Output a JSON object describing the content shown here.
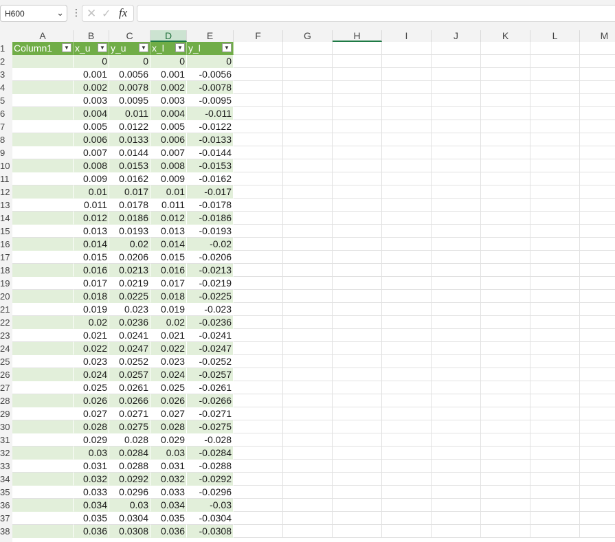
{
  "formula_bar": {
    "name_box": "H600",
    "chevron_icon": "chevron-down-icon",
    "more_icon": "more-dots-icon",
    "cancel_icon": "close-icon",
    "enter_icon": "check-icon",
    "fx_label": "fx",
    "formula_value": ""
  },
  "grid": {
    "columns": [
      "A",
      "B",
      "C",
      "D",
      "E",
      "F",
      "G",
      "H",
      "I",
      "J",
      "K",
      "L",
      "M"
    ],
    "selected_column": "D",
    "active_column": "H",
    "table_header_row": 1,
    "table_headers": [
      "Column1",
      "x_u",
      "y_u",
      "x_l",
      "y_l"
    ],
    "filter_icon": "dropdown-arrow-icon",
    "rows": [
      {
        "num": "2",
        "cells": [
          "",
          "0",
          "0",
          "0",
          "0"
        ]
      },
      {
        "num": "3",
        "cells": [
          "",
          "0.001",
          "0.0056",
          "0.001",
          "-0.0056"
        ]
      },
      {
        "num": "4",
        "cells": [
          "",
          "0.002",
          "0.0078",
          "0.002",
          "-0.0078"
        ]
      },
      {
        "num": "5",
        "cells": [
          "",
          "0.003",
          "0.0095",
          "0.003",
          "-0.0095"
        ]
      },
      {
        "num": "6",
        "cells": [
          "",
          "0.004",
          "0.011",
          "0.004",
          "-0.011"
        ]
      },
      {
        "num": "7",
        "cells": [
          "",
          "0.005",
          "0.0122",
          "0.005",
          "-0.0122"
        ]
      },
      {
        "num": "8",
        "cells": [
          "",
          "0.006",
          "0.0133",
          "0.006",
          "-0.0133"
        ]
      },
      {
        "num": "9",
        "cells": [
          "",
          "0.007",
          "0.0144",
          "0.007",
          "-0.0144"
        ]
      },
      {
        "num": "10",
        "cells": [
          "",
          "0.008",
          "0.0153",
          "0.008",
          "-0.0153"
        ]
      },
      {
        "num": "11",
        "cells": [
          "",
          "0.009",
          "0.0162",
          "0.009",
          "-0.0162"
        ]
      },
      {
        "num": "12",
        "cells": [
          "",
          "0.01",
          "0.017",
          "0.01",
          "-0.017"
        ]
      },
      {
        "num": "13",
        "cells": [
          "",
          "0.011",
          "0.0178",
          "0.011",
          "-0.0178"
        ]
      },
      {
        "num": "14",
        "cells": [
          "",
          "0.012",
          "0.0186",
          "0.012",
          "-0.0186"
        ]
      },
      {
        "num": "15",
        "cells": [
          "",
          "0.013",
          "0.0193",
          "0.013",
          "-0.0193"
        ]
      },
      {
        "num": "16",
        "cells": [
          "",
          "0.014",
          "0.02",
          "0.014",
          "-0.02"
        ]
      },
      {
        "num": "17",
        "cells": [
          "",
          "0.015",
          "0.0206",
          "0.015",
          "-0.0206"
        ]
      },
      {
        "num": "18",
        "cells": [
          "",
          "0.016",
          "0.0213",
          "0.016",
          "-0.0213"
        ]
      },
      {
        "num": "19",
        "cells": [
          "",
          "0.017",
          "0.0219",
          "0.017",
          "-0.0219"
        ]
      },
      {
        "num": "20",
        "cells": [
          "",
          "0.018",
          "0.0225",
          "0.018",
          "-0.0225"
        ]
      },
      {
        "num": "21",
        "cells": [
          "",
          "0.019",
          "0.023",
          "0.019",
          "-0.023"
        ]
      },
      {
        "num": "22",
        "cells": [
          "",
          "0.02",
          "0.0236",
          "0.02",
          "-0.0236"
        ]
      },
      {
        "num": "23",
        "cells": [
          "",
          "0.021",
          "0.0241",
          "0.021",
          "-0.0241"
        ]
      },
      {
        "num": "24",
        "cells": [
          "",
          "0.022",
          "0.0247",
          "0.022",
          "-0.0247"
        ]
      },
      {
        "num": "25",
        "cells": [
          "",
          "0.023",
          "0.0252",
          "0.023",
          "-0.0252"
        ]
      },
      {
        "num": "26",
        "cells": [
          "",
          "0.024",
          "0.0257",
          "0.024",
          "-0.0257"
        ]
      },
      {
        "num": "27",
        "cells": [
          "",
          "0.025",
          "0.0261",
          "0.025",
          "-0.0261"
        ]
      },
      {
        "num": "28",
        "cells": [
          "",
          "0.026",
          "0.0266",
          "0.026",
          "-0.0266"
        ]
      },
      {
        "num": "29",
        "cells": [
          "",
          "0.027",
          "0.0271",
          "0.027",
          "-0.0271"
        ]
      },
      {
        "num": "30",
        "cells": [
          "",
          "0.028",
          "0.0275",
          "0.028",
          "-0.0275"
        ]
      },
      {
        "num": "31",
        "cells": [
          "",
          "0.029",
          "0.028",
          "0.029",
          "-0.028"
        ]
      },
      {
        "num": "32",
        "cells": [
          "",
          "0.03",
          "0.0284",
          "0.03",
          "-0.0284"
        ]
      },
      {
        "num": "33",
        "cells": [
          "",
          "0.031",
          "0.0288",
          "0.031",
          "-0.0288"
        ]
      },
      {
        "num": "34",
        "cells": [
          "",
          "0.032",
          "0.0292",
          "0.032",
          "-0.0292"
        ]
      },
      {
        "num": "35",
        "cells": [
          "",
          "0.033",
          "0.0296",
          "0.033",
          "-0.0296"
        ]
      },
      {
        "num": "36",
        "cells": [
          "",
          "0.034",
          "0.03",
          "0.034",
          "-0.03"
        ]
      },
      {
        "num": "37",
        "cells": [
          "",
          "0.035",
          "0.0304",
          "0.035",
          "-0.0304"
        ]
      },
      {
        "num": "38",
        "cells": [
          "",
          "0.036",
          "0.0308",
          "0.036",
          "-0.0308"
        ]
      }
    ]
  },
  "colors": {
    "table_header_bg": "#70ad47",
    "table_band_bg": "#e2efda",
    "selected_column_bg": "#cce3d1",
    "active_accent": "#1f7a45"
  }
}
